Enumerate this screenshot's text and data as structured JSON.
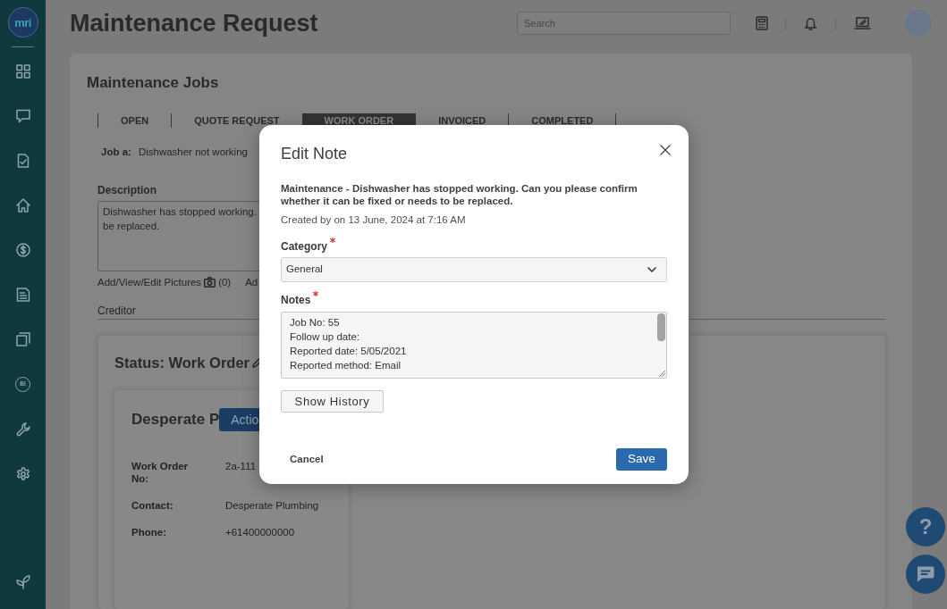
{
  "sidebar": {
    "logo": "mri",
    "bi_label": "BI"
  },
  "header": {
    "title": "Maintenance Request",
    "search": {
      "placeholder": "Search"
    }
  },
  "page": {
    "section_title": "Maintenance Jobs",
    "tabs": [
      {
        "label": "OPEN",
        "selected": false
      },
      {
        "label": "QUOTE REQUEST",
        "selected": false
      },
      {
        "label": "WORK ORDER",
        "selected": true
      },
      {
        "label": "INVOICED",
        "selected": false
      },
      {
        "label": "COMPLETED",
        "selected": false
      }
    ],
    "job": {
      "label": "Job a:",
      "value": "Dishwasher not working"
    },
    "description": {
      "label": "Description",
      "lines": [
        "Dishwasher has stopped working.",
        "be replaced."
      ]
    },
    "pictures_link": {
      "label": "Add/View/Edit Pictures",
      "count": "(0)"
    },
    "cut_link": "Ad",
    "creditor_label": "Creditor",
    "status": {
      "title": "Status: Work Order",
      "supplier": {
        "name": "Desperate P",
        "action_button": "Actio",
        "fields": [
          {
            "label": "Work Order No:",
            "value": "2a-111"
          },
          {
            "label": "Contact:",
            "value": "Desperate Plumbing"
          },
          {
            "label": "Phone:",
            "value": "+61400000000"
          }
        ]
      }
    }
  },
  "modal": {
    "title": "Edit Note",
    "summary": "Maintenance - Dishwasher has stopped working. Can you please confirm whether it can be fixed or needs to be replaced.",
    "created": "Created by on 13 June, 2024 at 7:16 AM",
    "category": {
      "label": "Category",
      "required": true,
      "value": "General"
    },
    "notes": {
      "label": "Notes",
      "required": true,
      "lines": [
        "Job No: 55",
        "Follow up date:",
        "Reported date: 5/05/2021",
        "Reported method: Email"
      ]
    },
    "show_history": "Show History",
    "cancel": "Cancel",
    "save": "Save"
  },
  "help_button": {
    "label": "?"
  }
}
